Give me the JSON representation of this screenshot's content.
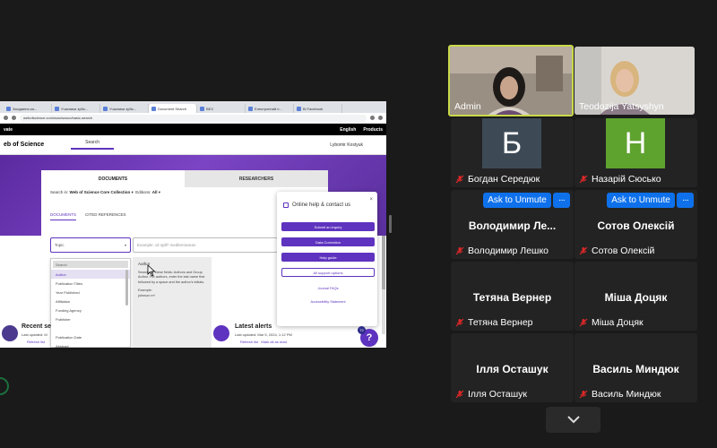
{
  "browser": {
    "tabs": [
      "Засідання ка...",
      "Учасники зуба...",
      "Учасники зуба...",
      "Document Search",
      "ВЕХ",
      "Електронний н...",
      "Ві Facebook"
    ],
    "url": "webofscience.com/wos/woscc/basic-search"
  },
  "wos": {
    "brand": "vate",
    "logo_text": "eb of Science",
    "language": "English",
    "products": "Products",
    "nav_search": "Search",
    "user": "Lybomir Kostyuk",
    "tab_documents": "DOCUMENTS",
    "tab_researchers": "RESEARCHERS",
    "search_in_label": "Search in:",
    "search_in_value": "Web of Science Core Collection",
    "editions_label": "Editions:",
    "editions_value": "All",
    "subtab_documents": "DOCUMENTS",
    "subtab_cited": "CITED REFERENCES",
    "field_select": "Topic",
    "field_placeholder": "Example: oil spill* mediterranean",
    "dropdown_search": "Search",
    "dropdown_items": [
      "Author",
      "Publication Titles",
      "Year Published",
      "Affiliation",
      "Publisher",
      "Funding Agency",
      "Publisher",
      "",
      "Publication Date",
      "Abstract"
    ],
    "tip_title": "Author",
    "tip_body": "Search for these fields: Authors and Group Author. For authors, enter the last name first followed by a space and the author's initials.",
    "tip_example_label": "Example:",
    "tip_example": "johnson m*",
    "help": {
      "title": "Online help & contact us",
      "close": "×",
      "submit": "Submit an inquiry",
      "data_correction": "Data Correction",
      "help_guide": "Help guide",
      "all_support": "All support options",
      "journal_faqs": "Journal FAQs",
      "accessibility": "Accessibility Statement"
    },
    "recent_title": "Recent se",
    "recent_sub": "Last updated: M",
    "recent_link": "Refresh list",
    "alerts_title": "Latest alerts",
    "alerts_sub": "Last updated: Mar 5, 2024, 1:12 PM",
    "alerts_refresh": "Refresh list",
    "alerts_mark": "Mark all as read",
    "fab_label": "?",
    "fab_badge": "72"
  },
  "participants": [
    {
      "name": "Admin",
      "type": "video",
      "muted": false
    },
    {
      "name": "Teodozija Yatsyshyn",
      "type": "video",
      "muted": false
    },
    {
      "name": "Богдан Середюк",
      "type": "avatar",
      "initial": "Б",
      "color": "#3d4a56",
      "muted": true
    },
    {
      "name": "Назарій Сюсько",
      "type": "avatar",
      "initial": "H",
      "color": "#5fa32f",
      "muted": true
    },
    {
      "name": "Володимир Лешко",
      "display": "Володимир  Ле...",
      "type": "text",
      "muted": true,
      "unmute": true
    },
    {
      "name": "Сотов Олексій",
      "display": "Сотов Олексій",
      "type": "text",
      "muted": true,
      "unmute": true
    },
    {
      "name": "Тетяна Вернер",
      "display": "Тетяна Вернер",
      "type": "text",
      "muted": true
    },
    {
      "name": "Міша Доцяк",
      "display": "Міша Доцяк",
      "type": "text",
      "muted": true
    },
    {
      "name": "Ілля Осташук",
      "display": "Ілля Осташук",
      "type": "text",
      "muted": true
    },
    {
      "name": "Василь Миндюк",
      "display": "Василь Миндюк",
      "type": "text",
      "muted": true
    }
  ],
  "controls": {
    "ask_to_unmute": "Ask to Unmute",
    "more": "···"
  },
  "colors": {
    "accent": "#5e33bf",
    "zoom_blue": "#0e71eb",
    "speaker_border": "#c8d94a",
    "muted_red": "#e02828"
  }
}
